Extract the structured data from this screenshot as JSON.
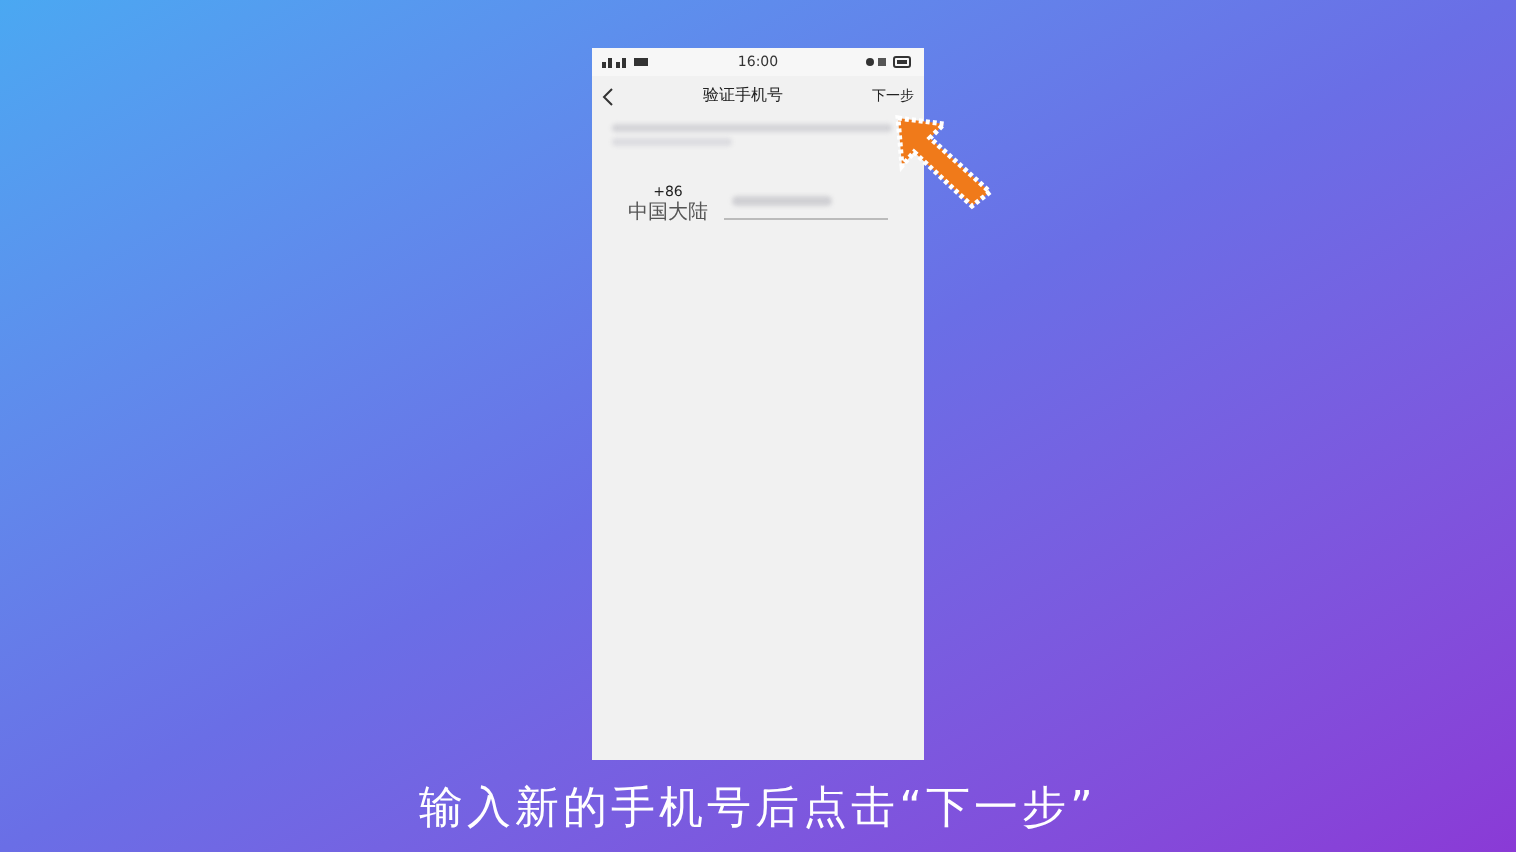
{
  "status_bar": {
    "time": "16:00"
  },
  "header": {
    "title": "验证手机号",
    "next_button": "下一步"
  },
  "phone_field": {
    "country_code": "+86",
    "region": "中国大陆"
  },
  "caption": "输入新的手机号后点击“下一步”"
}
